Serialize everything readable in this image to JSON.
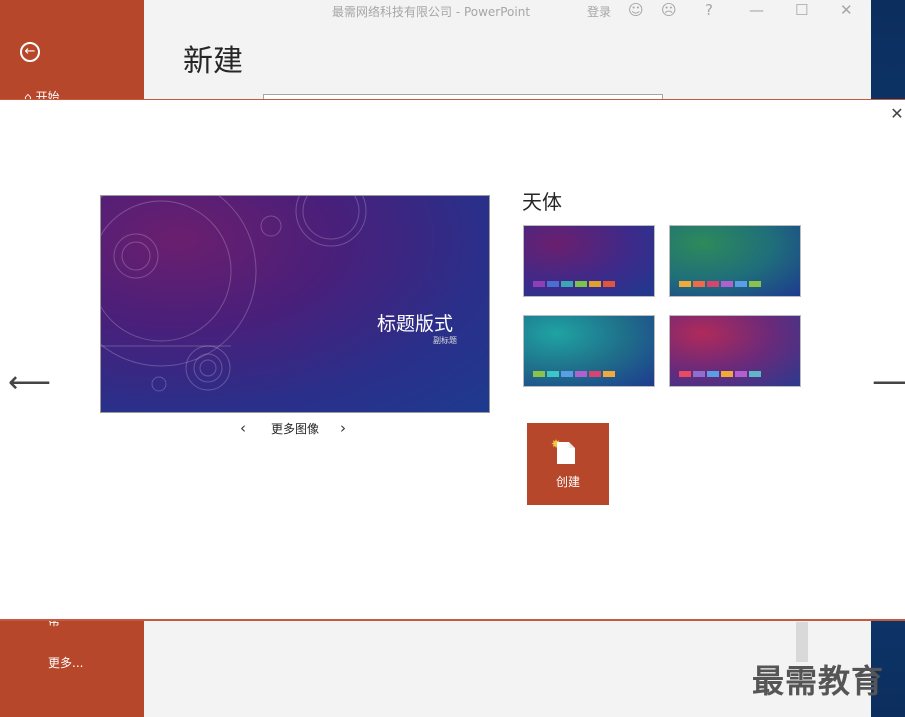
{
  "window": {
    "title": "最需网络科技有限公司  -  PowerPoint",
    "sign_in": "登录",
    "help_icon": "?"
  },
  "backstage": {
    "page_title": "新建",
    "sidebar": {
      "start_label": "开始",
      "partial_label": "帮",
      "more_label": "更多..."
    }
  },
  "watermark": "最需教育",
  "modal": {
    "preview": {
      "slide_title": "标题版式",
      "slide_subtitle": "副标题"
    },
    "more_images_label": "更多图像",
    "theme_name": "天体",
    "variants": [
      {
        "name": "purple",
        "swatches": [
          "#8e3fb8",
          "#4a6fd0",
          "#3aa6b8",
          "#7cc14a",
          "#e0a030",
          "#e0563a"
        ]
      },
      {
        "name": "green",
        "swatches": [
          "#f2a93b",
          "#ee6a4a",
          "#d6456f",
          "#b25fd0",
          "#5a9ee6",
          "#8bc34a"
        ]
      },
      {
        "name": "teal",
        "swatches": [
          "#8bc34a",
          "#3ec6c6",
          "#5a9ee6",
          "#b25fd0",
          "#d6456f",
          "#f2a93b"
        ]
      },
      {
        "name": "magenta",
        "swatches": [
          "#e84a5f",
          "#8e6fd0",
          "#5a9ee6",
          "#f2a93b",
          "#b25fd0",
          "#5fb8c8"
        ]
      }
    ],
    "create_label": "创建"
  },
  "colors": {
    "accent": "#b7472a",
    "background": "#f3f3f3"
  }
}
